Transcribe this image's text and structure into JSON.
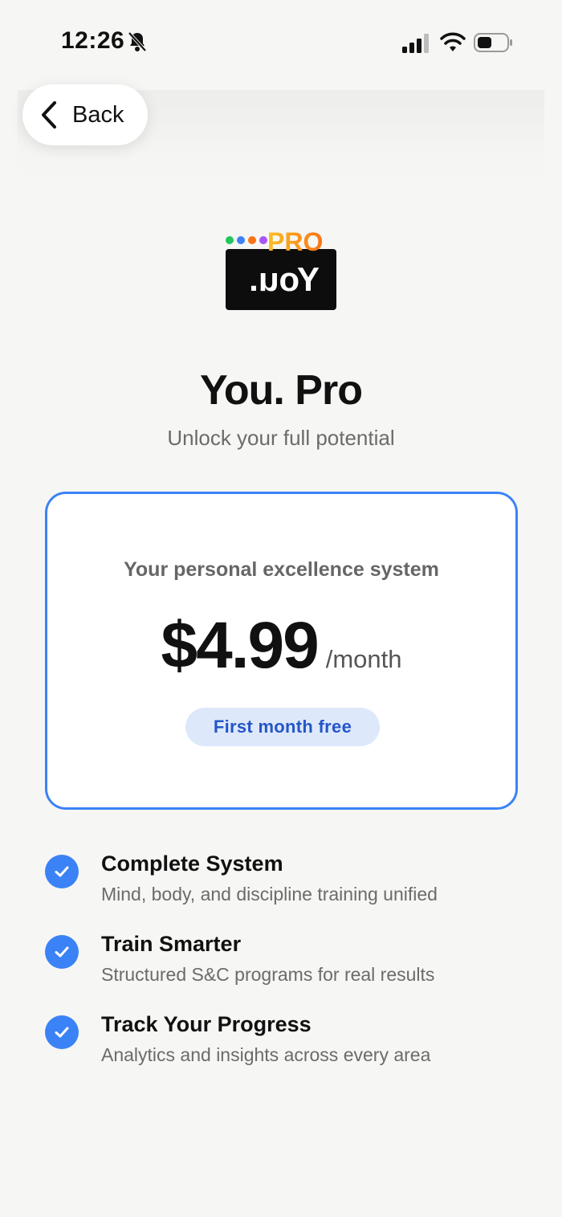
{
  "status_bar": {
    "time": "12:26",
    "icons": [
      "bell-slash-icon",
      "cellular-signal-icon",
      "wifi-icon",
      "battery-icon"
    ]
  },
  "nav": {
    "back_label": "Back"
  },
  "logo": {
    "badge_text": "PRO",
    "mark_text": "You.",
    "dot_colors": [
      "#22c55e",
      "#3b82f6",
      "#f97316",
      "#a855f7"
    ]
  },
  "header": {
    "title": "You. Pro",
    "subtitle": "Unlock your full potential"
  },
  "plan_card": {
    "tagline": "Your personal excellence system",
    "price": "$4.99",
    "period": "/month",
    "promo": "First month free"
  },
  "features": [
    {
      "title": "Complete System",
      "description": "Mind, body, and discipline training unified"
    },
    {
      "title": "Train Smarter",
      "description": "Structured S&C programs for real results"
    },
    {
      "title": "Track Your Progress",
      "description": "Analytics and insights across every area"
    }
  ],
  "colors": {
    "accent": "#3b82f6",
    "promo_bg": "#dde8fb",
    "promo_text": "#2456c8",
    "background": "#f6f6f4"
  }
}
